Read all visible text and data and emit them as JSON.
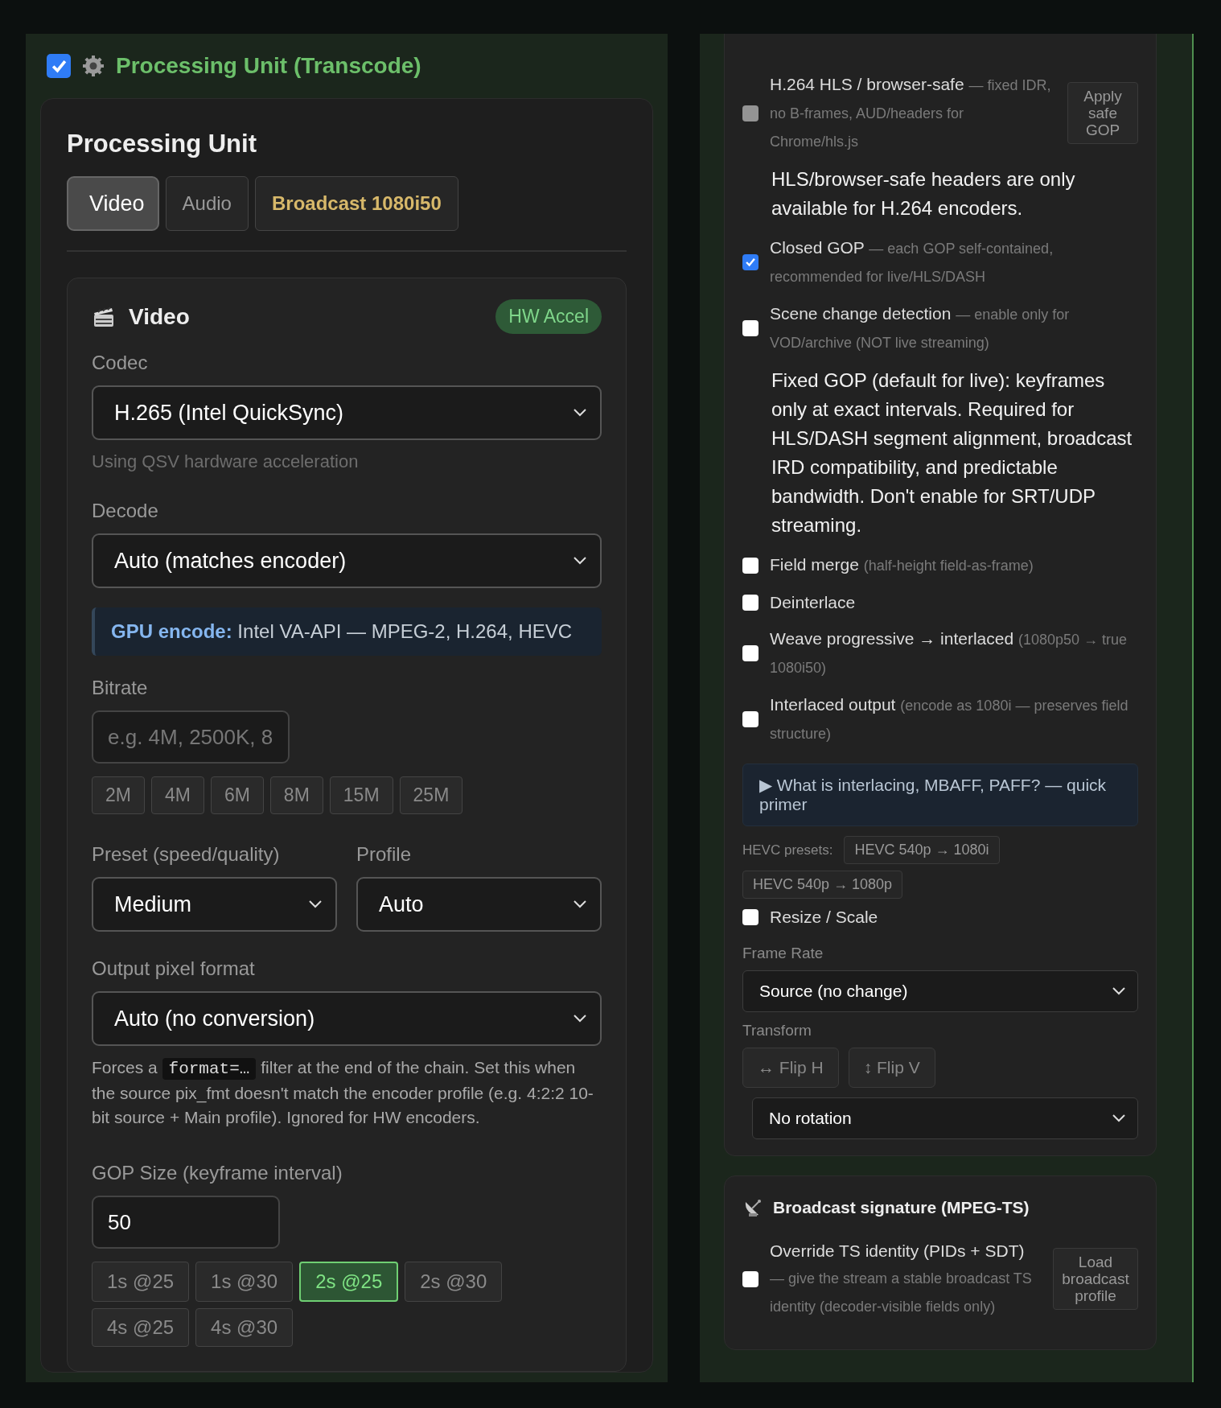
{
  "left_panel": {
    "enabled": true,
    "title": "Processing Unit (Transcode)",
    "card": {
      "heading": "Processing Unit",
      "tabs": [
        {
          "label": "Video",
          "selected": true,
          "kind": "tab"
        },
        {
          "label": "Audio",
          "selected": false,
          "kind": "tab"
        },
        {
          "label": "Broadcast 1080i50",
          "selected": false,
          "kind": "preset"
        }
      ],
      "video": {
        "title": "Video",
        "badge": "HW Accel",
        "codec": {
          "label": "Codec",
          "value": "H.265 (Intel QuickSync)",
          "hint": "Using QSV hardware acceleration"
        },
        "decode": {
          "label": "Decode",
          "value": "Auto (matches encoder)"
        },
        "gpu_note": "**GPU encode:** Intel VA-API — MPEG-2, H.264, HEVC",
        "bitrate": {
          "label": "Bitrate",
          "placeholder": "e.g. 4M, 2500K, 8",
          "chips": [
            "2M",
            "4M",
            "6M",
            "8M",
            "15M",
            "25M"
          ]
        },
        "preset": {
          "label": "Preset (speed/quality)",
          "value": "Medium"
        },
        "profile": {
          "label": "Profile",
          "value": "Auto"
        },
        "pixel_format": {
          "label": "Output pixel format",
          "value": "Auto (no conversion)",
          "help_before": "Forces a",
          "help_code": "format=…",
          "help_after": "filter at the end of the chain. Set this when the source pix_fmt doesn't match the encoder profile (e.g. 4:2:2 10-bit source + Main profile). Ignored for HW encoders."
        },
        "gop": {
          "label": "GOP Size (keyframe interval)",
          "value": "50",
          "chips": [
            {
              "label": "1s @25",
              "selected": false
            },
            {
              "label": "1s @30",
              "selected": false
            },
            {
              "label": "2s @25",
              "selected": true
            },
            {
              "label": "2s @30",
              "selected": false
            },
            {
              "label": "4s @25",
              "selected": false
            },
            {
              "label": "4s @30",
              "selected": false
            }
          ]
        }
      }
    }
  },
  "right_panel": {
    "items": [
      {
        "kind": "checkbox",
        "label": "H.264 HLS / browser-safe",
        "desc": "— fixed IDR, no B-frames, AUD/headers for Chrome/hls.js",
        "checked": false,
        "disabled": true,
        "button": "Apply safe GOP"
      },
      {
        "kind": "note",
        "text": "HLS/browser-safe headers are only available for H.264 encoders."
      },
      {
        "kind": "checkbox",
        "label": "Closed GOP",
        "desc": "— each GOP self-contained, recommended for live/HLS/DASH",
        "checked": true
      },
      {
        "kind": "checkbox",
        "label": "Scene change detection",
        "desc": "— enable only for VOD/archive (NOT live streaming)",
        "checked": false
      },
      {
        "kind": "note",
        "text": "Fixed GOP (default for live): keyframes only at exact intervals. Required for HLS/DASH segment alignment, broadcast IRD compatibility, and predictable bandwidth. Don't enable for SRT/UDP streaming."
      },
      {
        "kind": "checkbox",
        "label": "Field merge",
        "desc": "(half-height field-as-frame)",
        "checked": false
      },
      {
        "kind": "checkbox",
        "label": "Deinterlace",
        "checked": false
      },
      {
        "kind": "checkbox",
        "label": "Weave progressive → interlaced",
        "desc": "(1080p50 → true 1080i50)",
        "checked": false
      },
      {
        "kind": "checkbox",
        "label": "Interlaced output",
        "desc": "(encode as 1080i — preserves field structure)",
        "checked": false
      },
      {
        "kind": "details",
        "text": "▶ What is interlacing, MBAFF, PAFF? — quick primer"
      },
      {
        "kind": "presets",
        "label": "HEVC presets:",
        "buttons": [
          "HEVC 540p → 1080i",
          "HEVC 540p → 1080p"
        ]
      },
      {
        "kind": "checkbox",
        "label": "Resize / Scale",
        "checked": false
      },
      {
        "kind": "select",
        "label": "Frame Rate",
        "value": "Source (no change)"
      },
      {
        "kind": "transform",
        "label": "Transform",
        "buttons": [
          "↔ Flip H",
          "↕ Flip V"
        ],
        "value": "No rotation"
      }
    ],
    "signature": {
      "title": "Broadcast signature (MPEG-TS)",
      "label": "Override TS identity (PIDs + SDT)",
      "desc": "— give the stream a stable broadcast TS identity (decoder-visible fields only)",
      "checked": false,
      "button": "Load broadcast profile"
    }
  }
}
